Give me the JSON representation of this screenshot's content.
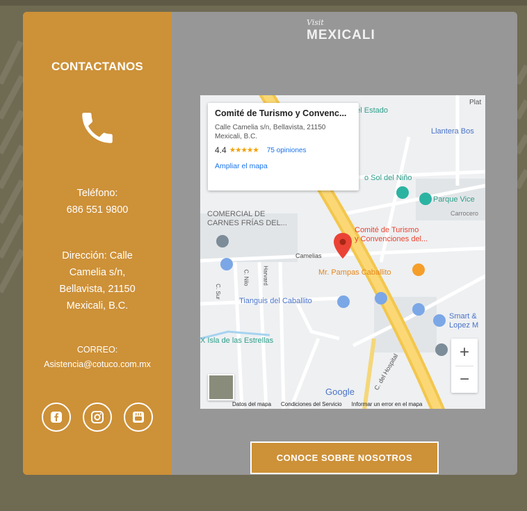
{
  "contact": {
    "title": "CONTACTANOS",
    "phone_icon": "phone-icon",
    "phone_label": "Teléfono:",
    "phone_number": "686 551 9800",
    "address_lines": [
      "Dirección: Calle",
      "Camelia s/n,",
      "Bellavista, 21150",
      "Mexicali, B.C."
    ],
    "email_label": "CORREO:",
    "email": "Asistencia@cotuco.com.mx",
    "socials": [
      "facebook-icon",
      "instagram-icon",
      "youtube-icon"
    ]
  },
  "logo": {
    "small": "Visit",
    "big": "MEXICALI"
  },
  "map": {
    "infowindow": {
      "title": "Comité de Turismo y Convenc...",
      "address": "Calle Camelia s/n, Bellavista, 21150 Mexicali, B.C.",
      "rating": "4.4",
      "stars": "★★★★★",
      "reviews": "75 opiniones",
      "enlarge": "Ampliar el mapa"
    },
    "labels": {
      "estado": "del Estado",
      "plat": "Plat",
      "llantera": "Llantera Bos",
      "sol": "o Sol del Niño",
      "parque": "Parque Vice",
      "carrocero": "Carrocero",
      "comercial": "COMERCIAL DE\nCARNES FRÍAS DEL...",
      "comite": "Comité de Turismo\ny Convenciones del...",
      "camelias": "Camelias",
      "pampas": "Mr. Pampas Caballito",
      "tianguis": "Tianguis del Caballito",
      "smart": "Smart &\nLopez M",
      "isla": "X Isla de las Estrellas",
      "hospital": "C. del Hospital",
      "street_sur": "C. Sur",
      "street_nilo": "C. Nilo",
      "street_harvard": "Harvard"
    },
    "google": "Google",
    "footer": [
      "Datos del mapa",
      "Condiciones del Servicio",
      "Informar un error en el mapa"
    ],
    "zoom_in": "+",
    "zoom_out": "−"
  },
  "cta": {
    "label": "CONOCE SOBRE NOSOTROS"
  },
  "colors": {
    "sidebar": "#cd9138",
    "card": "#979797",
    "background": "#6f6a52"
  }
}
